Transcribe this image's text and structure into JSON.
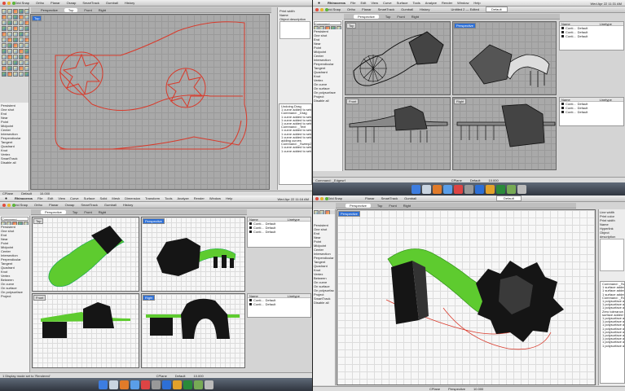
{
  "quad1": {
    "toolbar": [
      "Grid Snap",
      "Ortho",
      "Planar",
      "Osnap",
      "SmartTrack",
      "Gumball",
      "History"
    ],
    "tabs": [
      "Perspective",
      "Top",
      "Front",
      "Right"
    ],
    "active_tab": "Top",
    "viewport_label": "Top",
    "side_items": [
      "Persistent",
      "One shot",
      "End",
      "Near",
      "Point",
      "Midpoint",
      "Center",
      "Intersection",
      "Perpendicular",
      "Tangent",
      "Quadrant",
      "Knot",
      "Vertex",
      "SmartTrack",
      "Disable all"
    ],
    "panel": [
      "Print width",
      "Name",
      "Object description"
    ],
    "command_lines": [
      "Undoing Drag",
      "1 curve added to selection",
      "Command: _Drag",
      "1 curve added to selection",
      "1 curve added to selection",
      "1 curve added to selection",
      "Command: _Text",
      "1 curve added to selection",
      "1 curve added to selection",
      "1 curve added to selection",
      "adding curves",
      "Command: _Sweep2",
      "1 curve added to selection",
      "1 curve added to selection"
    ],
    "status": [
      "CPlane",
      "Default",
      "10.000"
    ]
  },
  "quad2": {
    "menubar": [
      "Rhinoceros",
      "File",
      "Edit",
      "View",
      "Curve",
      "Surface",
      "Tools",
      "Analyze",
      "Render",
      "Window",
      "Help"
    ],
    "clock": "Wed Apr 22 11:31 AM",
    "title": "Untitled 2 — Edited",
    "toolbar": [
      "Grid Snap",
      "Ortho",
      "Planar",
      "SmartTrack",
      "Gumball",
      "History"
    ],
    "layer_select": "Default",
    "tabs": [
      "Perspective",
      "Top",
      "Front",
      "Right"
    ],
    "viewport_labels": [
      "Top",
      "Perspective",
      "Front",
      "Right"
    ],
    "command_label": "Command",
    "side_items": [
      "Persistent",
      "One shot",
      "End",
      "Near",
      "Point",
      "Midpoint",
      "Center",
      "Intersection",
      "Perpendicular",
      "Tangent",
      "Quadrant",
      "Knot",
      "Vertex",
      "On curve",
      "On surface",
      "On polysurface",
      "Project",
      "Disable all"
    ],
    "layers_header": [
      "Name",
      "Linetype"
    ],
    "layer_rows": [
      "Default",
      "Default",
      "Default",
      "Default",
      "Default",
      "Default"
    ],
    "layer_cont": "Conti...",
    "command_prompt": "Command: _Edgesrf",
    "status": [
      "CPlane",
      "Default",
      "10.000"
    ]
  },
  "quad3": {
    "menubar": [
      "Rhinoceros",
      "File",
      "Edit",
      "View",
      "Curve",
      "Surface",
      "Solid",
      "Mesh",
      "Dimension",
      "Transform",
      "Tools",
      "Analyze",
      "Render",
      "Window",
      "Help"
    ],
    "clock": "Wed Apr 22 11:16 AM",
    "toolbar": [
      "Grid Snap",
      "Ortho",
      "Planar",
      "Osnap",
      "SmartTrack",
      "Gumball",
      "History"
    ],
    "tabs": [
      "Perspective",
      "Top",
      "Front",
      "Right"
    ],
    "command_label": "Command",
    "viewport_labels": [
      "Top",
      "Perspective",
      "Front",
      "Right"
    ],
    "side_items": [
      "Persistent",
      "One shot",
      "End",
      "Near",
      "Point",
      "Midpoint",
      "Center",
      "Intersection",
      "Perpendicular",
      "Tangent",
      "Quadrant",
      "Knot",
      "Vertex",
      "Between",
      "On curve",
      "On surface",
      "On polysurface",
      "Project"
    ],
    "layers_header": [
      "Name",
      "Linetype"
    ],
    "layer_rows": [
      "Default",
      "Default",
      "Default",
      "Default",
      "Default"
    ],
    "layer_cont": "Conti...",
    "command_prompt": "1 Display mode set to 'Rendered'",
    "status": [
      "CPlane",
      "Default",
      "10.000"
    ]
  },
  "quad4": {
    "toolbar": [
      "Grid Snap",
      "Planar",
      "SmartTrack",
      "Gumball"
    ],
    "layer_select": "Default",
    "tabs": [
      "Perspective",
      "Top",
      "Front",
      "Right"
    ],
    "viewport_label": "Perspective",
    "side_items": [
      "Persistent",
      "One shot",
      "End",
      "Near",
      "Point",
      "Midpoint",
      "Center",
      "Intersection",
      "Perpendicular",
      "Tangent",
      "Quadrant",
      "Knot",
      "Vertex",
      "Between",
      "On curve",
      "On surface",
      "On polysurface",
      "Project",
      "SmartTrack",
      "Disable all"
    ],
    "panel": [
      "Line width",
      "Print color",
      "Print width",
      "Name",
      "Hyperlink",
      "Object description"
    ],
    "command_lines": [
      "Command: _Sweep2",
      "1 surface added to selection",
      "1 surface added to selection",
      "1 surface added to selection",
      "Command: _Rotate",
      "1 polysurface added to selection",
      "1 polysurface added to selection",
      "1 polysurface added to selection",
      "Zero tolerance...",
      "surface added to selection",
      "1 polysurface added to selection",
      "1 polysurface added to selection",
      "1 polysurface added to selection",
      "1 polysurface added to selection",
      "1 polysurface added to selection",
      "1 polysurface added to selection",
      "1 polysurface added to selection",
      "1 polysurface added to selection",
      "1 polysurface added to selection"
    ],
    "status": [
      "CPlane",
      "Perspective",
      "10.000"
    ]
  },
  "colors": {
    "curve": "#d93a2b",
    "surface": "#5ecb2f",
    "solid": "#151515",
    "accent": "#2d6fd6"
  }
}
